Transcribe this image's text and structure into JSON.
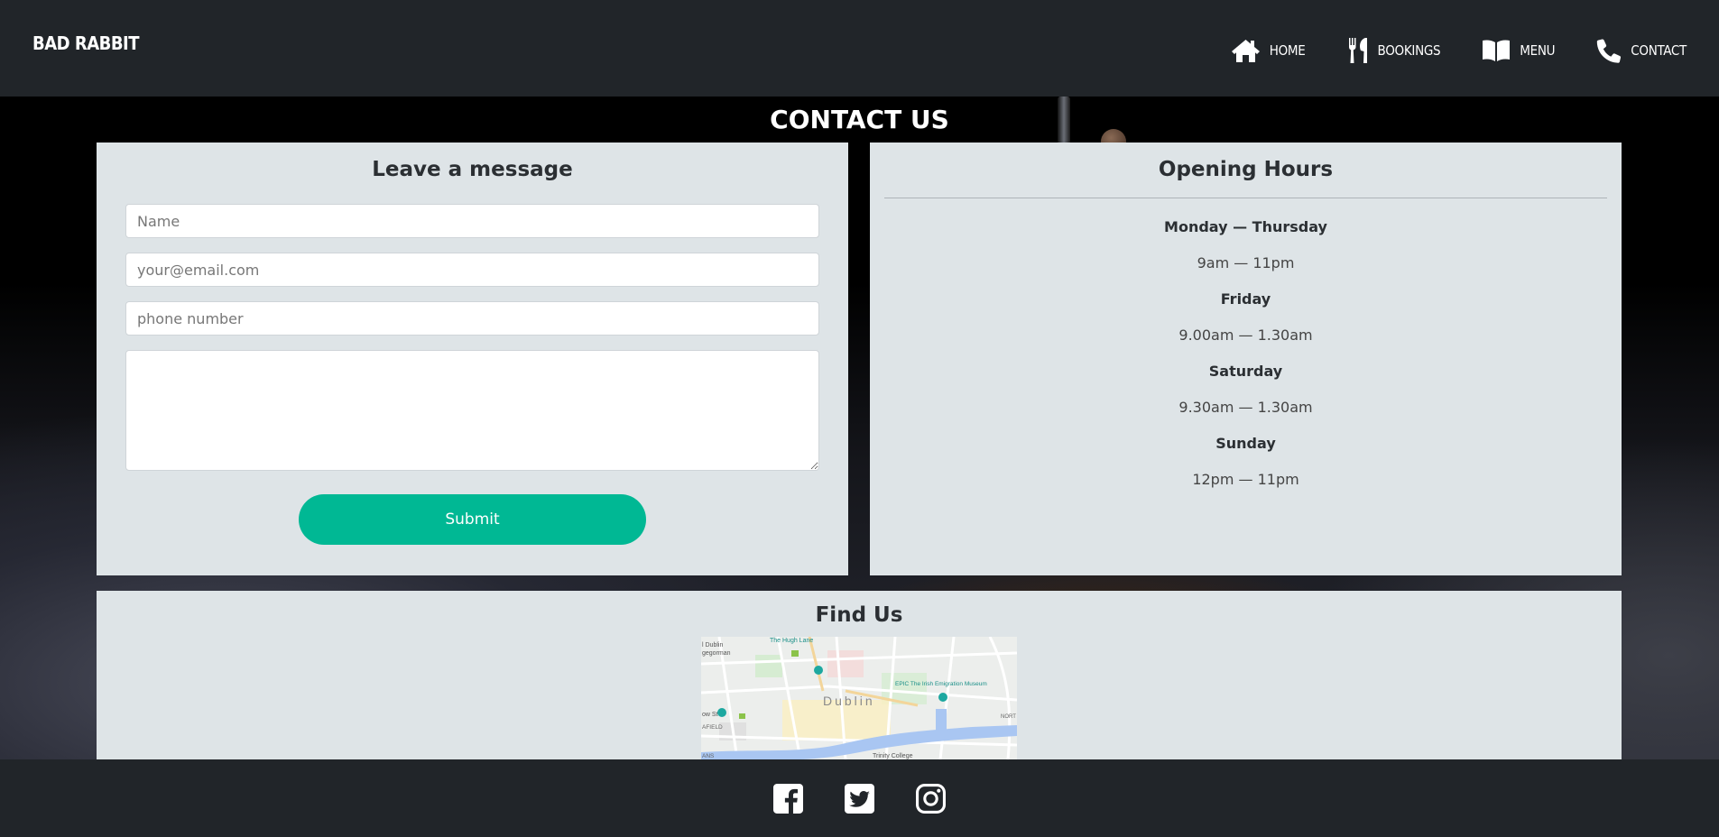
{
  "navbar": {
    "brand": "BAD RABBIT",
    "items": [
      {
        "label": "HOME",
        "icon": "home-icon"
      },
      {
        "label": "BOOKINGS",
        "icon": "fork-knife-icon"
      },
      {
        "label": "MENU",
        "icon": "book-icon"
      },
      {
        "label": "CONTACT",
        "icon": "phone-icon"
      }
    ]
  },
  "page": {
    "title": "CONTACT US"
  },
  "message_form": {
    "heading": "Leave a message",
    "name_placeholder": "Name",
    "email_placeholder": "your@email.com",
    "phone_placeholder": "phone number",
    "message_value": "",
    "submit_label": "Submit",
    "accent": "#00b894"
  },
  "opening_hours": {
    "heading": "Opening Hours",
    "entries": [
      {
        "day": "Monday — Thursday",
        "time": "9am — 11pm"
      },
      {
        "day": "Friday",
        "time": "9.00am — 1.30am"
      },
      {
        "day": "Saturday",
        "time": "9.30am — 1.30am"
      },
      {
        "day": "Sunday",
        "time": "12pm — 11pm"
      }
    ]
  },
  "find_us": {
    "heading": "Find Us",
    "map_labels": {
      "city": "Dublin",
      "poi_1": "The Hugh Lane",
      "poi_2": "EPIC The Irish Emigration Museum",
      "poi_3": "Trinity College",
      "area_1": "l Dublin",
      "area_2": "gegorman",
      "area_3": "AFIELD",
      "area_4": "NORT",
      "area_5": "ow St",
      "area_6": "ANS"
    }
  },
  "footer": {
    "social": [
      "facebook-icon",
      "twitter-icon",
      "instagram-icon"
    ]
  }
}
